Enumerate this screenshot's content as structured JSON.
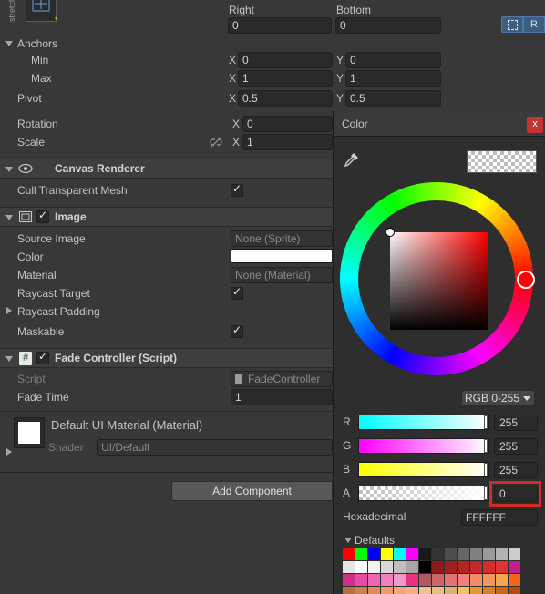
{
  "rect_transform": {
    "preset_label": "stretch",
    "right": {
      "label": "Right",
      "value": "0"
    },
    "bottom": {
      "label": "Bottom",
      "value": "0"
    },
    "blueprint_btn": "R",
    "anchors": {
      "label": "Anchors",
      "min": {
        "label": "Min",
        "x": "0",
        "y": "0"
      },
      "max": {
        "label": "Max",
        "x": "1",
        "y": "1"
      }
    },
    "pivot": {
      "label": "Pivot",
      "x": "0.5",
      "y": "0.5"
    },
    "rotation": {
      "label": "Rotation",
      "x": "0"
    },
    "scale": {
      "label": "Scale",
      "x": "1"
    },
    "axis_x": "X",
    "axis_y": "Y"
  },
  "canvas_renderer": {
    "title": "Canvas Renderer",
    "cull_label": "Cull Transparent Mesh",
    "cull_checked": true
  },
  "image": {
    "title": "Image",
    "source_image": {
      "label": "Source Image",
      "value": "None (Sprite)"
    },
    "color": {
      "label": "Color",
      "value": "#ffffff"
    },
    "material": {
      "label": "Material",
      "value": "None (Material)"
    },
    "raycast_target": {
      "label": "Raycast Target",
      "checked": true
    },
    "raycast_padding": {
      "label": "Raycast Padding"
    },
    "maskable": {
      "label": "Maskable",
      "checked": true
    }
  },
  "fade_controller": {
    "title": "Fade Controller (Script)",
    "script": {
      "label": "Script",
      "value": "FadeController"
    },
    "fade_time": {
      "label": "Fade Time",
      "value": "1"
    }
  },
  "material_section": {
    "title": "Default UI Material (Material)",
    "shader_label": "Shader",
    "shader_value": "UI/Default"
  },
  "add_component": "Add Component",
  "color_picker": {
    "title": "Color",
    "close": "x",
    "mode": "RGB 0-255",
    "channels": [
      {
        "label": "R",
        "value": "255"
      },
      {
        "label": "G",
        "value": "255"
      },
      {
        "label": "B",
        "value": "255"
      },
      {
        "label": "A",
        "value": "0"
      }
    ],
    "hex_label": "Hexadecimal",
    "hex_value": "FFFFFF",
    "defaults_label": "Defaults",
    "swatch_rows": [
      [
        "#ff0000",
        "#00ff00",
        "#0000ff",
        "#ffff00",
        "#00ffff",
        "#ff00ff",
        "#1a1a1a",
        "#333333",
        "#4d4d4d",
        "#666666",
        "#808080",
        "#999999",
        "#b3b3b3",
        "#cccccc"
      ],
      [
        "#e6e6e6",
        "#ffffff",
        "#f2f2f2",
        "#d9d9d9",
        "#bfbfbf",
        "#a6a6a6",
        "#000000",
        "#8c1a1a",
        "#a31f1f",
        "#b32424",
        "#c22929",
        "#d12e2e",
        "#e03333",
        "#c21f8c"
      ],
      [
        "#d12e8c",
        "#e64da6",
        "#f066b3",
        "#f280bf",
        "#f299cc",
        "#e63380",
        "#b35959",
        "#cc6666",
        "#e07373",
        "#f28080",
        "#f28c66",
        "#f29959",
        "#f2a64d",
        "#f26619"
      ],
      [
        "#b37340",
        "#cc8052",
        "#e08c59",
        "#f29966",
        "#f2a680",
        "#f2b380",
        "#f2bf99",
        "#e6c080",
        "#d9b373",
        "#f2c066",
        "#e69933",
        "#d98026",
        "#cc6619",
        "#b34d0d"
      ]
    ]
  }
}
